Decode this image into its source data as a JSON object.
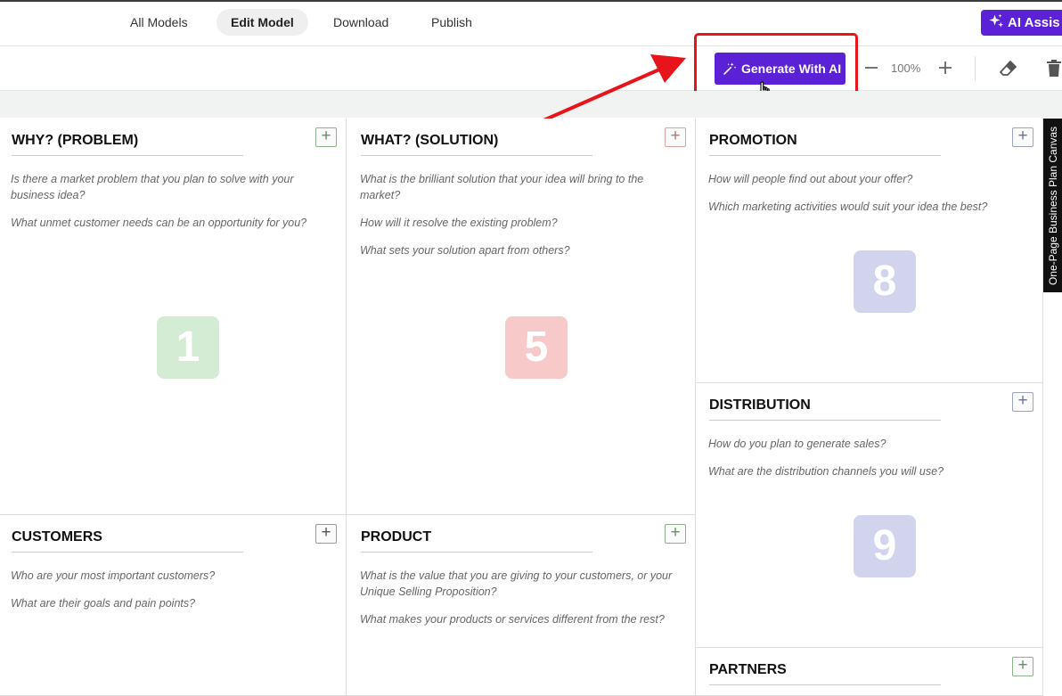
{
  "nav": {
    "tabs": [
      {
        "label": "All Models"
      },
      {
        "label": "Edit Model"
      },
      {
        "label": "Download"
      },
      {
        "label": "Publish"
      }
    ],
    "ai_assist_label": "AI Assis"
  },
  "toolbar": {
    "generate_label": "Generate With AI",
    "zoom_level": "100%"
  },
  "side_tab_label": "One-Page Business Plan Canvas",
  "colors": {
    "accent": "#5b21d6",
    "highlight": "#e8141b",
    "green_badge": "#d3ecd3",
    "red_badge": "#f8c9c9",
    "blue_badge": "#d2d4ee"
  },
  "canvas": {
    "why": {
      "title": "WHY? (PROBLEM)",
      "questions": [
        "Is there a market problem that you plan to solve with your business idea?",
        "What unmet customer needs can be an opportunity for you?"
      ],
      "number": "1"
    },
    "what": {
      "title": "WHAT? (SOLUTION)",
      "questions": [
        "What is the brilliant solution that your idea will bring to the market?",
        "How will it resolve the existing problem?",
        "What sets your solution apart from others?"
      ],
      "number": "5"
    },
    "promotion": {
      "title": "PROMOTION",
      "questions": [
        "How will people find out about your offer?",
        "Which marketing activities would suit your idea the best?"
      ],
      "number": "8"
    },
    "distribution": {
      "title": "DISTRIBUTION",
      "questions": [
        "How do you plan to generate sales?",
        "What are the distribution channels you will use?"
      ],
      "number": "9"
    },
    "customers": {
      "title": "CUSTOMERS",
      "questions": [
        "Who are your most important customers?",
        "What are their goals and pain points?"
      ]
    },
    "product": {
      "title": "PRODUCT",
      "questions": [
        "What is the value that you are giving to your customers, or your Unique Selling Proposition?",
        "What makes your products or services different from the rest?"
      ]
    },
    "partners": {
      "title": "PARTNERS"
    }
  }
}
